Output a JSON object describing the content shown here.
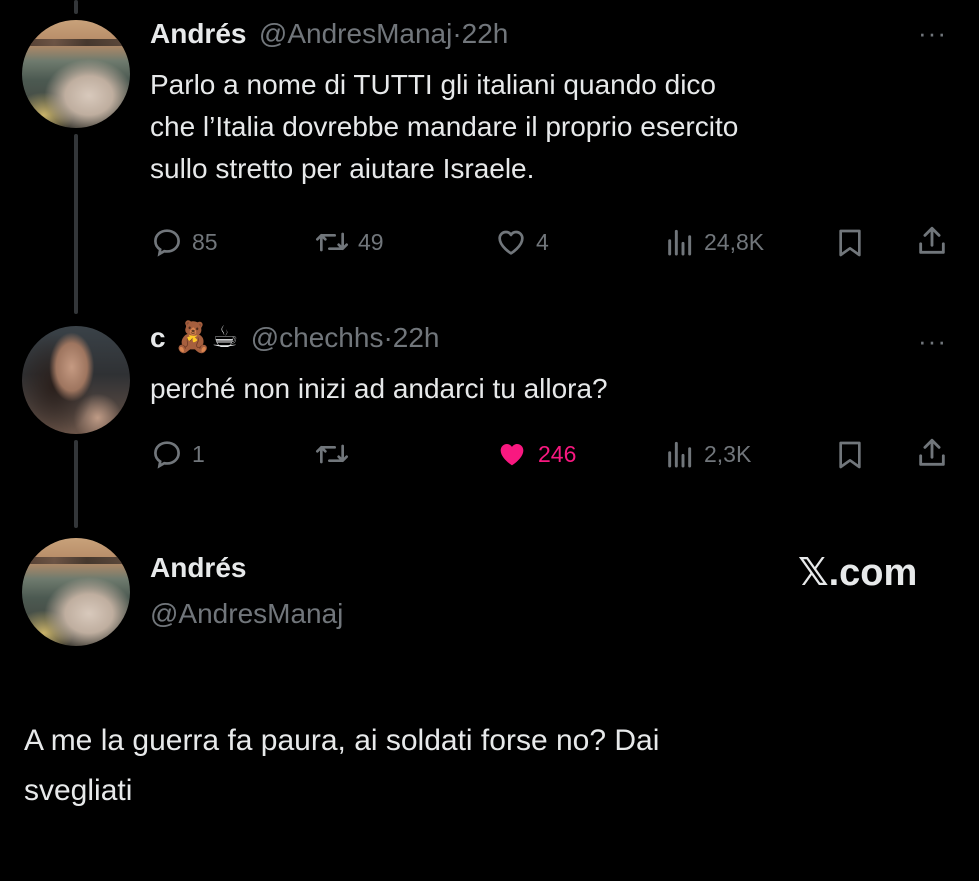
{
  "tweet1": {
    "name": "Andrés",
    "handle": "@AndresManaj",
    "sep": "·",
    "time": "22h",
    "more": "···",
    "text_lines": [
      "Parlo a nome di TUTTI gli italiani quando dico",
      "che l’Italia dovrebbe mandare il proprio esercito",
      "sullo stretto per aiutare Israele."
    ],
    "replies": "85",
    "retweets": "49",
    "likes": "4",
    "views": "24,8K"
  },
  "tweet2": {
    "name": "c",
    "name_emojis": "🧸☕",
    "handle": "@chechhs",
    "sep": "·",
    "time": "22h",
    "more": "···",
    "text": "perché non inizi ad andarci tu allora?",
    "replies": "1",
    "retweets": "",
    "likes": "246",
    "views": "2,3K",
    "like_color": "#f91880"
  },
  "quote": {
    "name": "Andrés",
    "handle": "@AndresManaj",
    "brand": "𝕏.com",
    "text_lines": [
      "A me la guerra fa paura, ai soldati forse no? Dai",
      "svegliati"
    ]
  },
  "icons": {
    "reply": "reply-icon",
    "retweet": "retweet-icon",
    "like": "heart-icon",
    "views": "views-icon",
    "bookmark": "bookmark-icon",
    "share": "share-icon"
  }
}
